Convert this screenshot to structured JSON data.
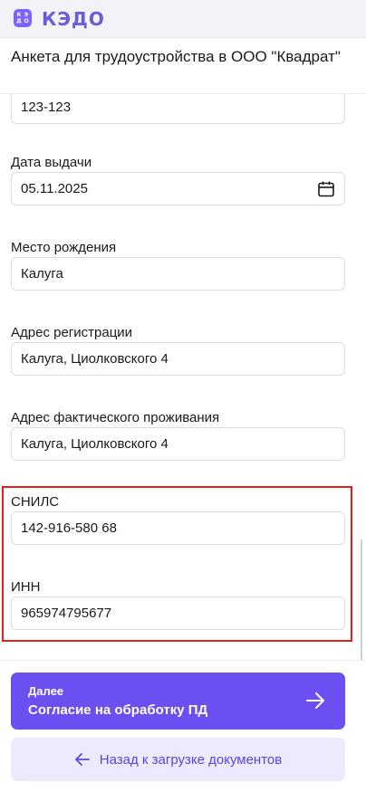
{
  "app": {
    "logo_letters": [
      "К",
      "Э",
      "Д",
      "О"
    ],
    "logo_text": "КЭДО"
  },
  "header": {
    "title": "Анкета для трудоустройства в ООО \"Квадрат\""
  },
  "form": {
    "passport_number": {
      "value": "123-123"
    },
    "issue_date": {
      "label": "Дата выдачи",
      "value": "05.11.2025",
      "icon": "calendar-icon"
    },
    "birth_place": {
      "label": "Место рождения",
      "value": "Калуга"
    },
    "registration_address": {
      "label": "Адрес регистрации",
      "value": "Калуга, Циолковского 4"
    },
    "actual_address": {
      "label": "Адрес фактического проживания",
      "value": "Калуга, Циолковского 4"
    },
    "snils": {
      "label": "СНИЛС",
      "value": "142-916-580 68"
    },
    "inn": {
      "label": "ИНН",
      "value": "965974795677"
    }
  },
  "footer": {
    "next_small": "Далее",
    "next_main": "Согласие на обработку ПД",
    "next_icon": "arrow-right-icon",
    "back_label": "Назад к загрузке документов",
    "back_icon": "arrow-left-icon"
  },
  "colors": {
    "accent": "#6b4ff0",
    "highlight": "#e0201a",
    "secondary_bg": "#eceafc"
  }
}
